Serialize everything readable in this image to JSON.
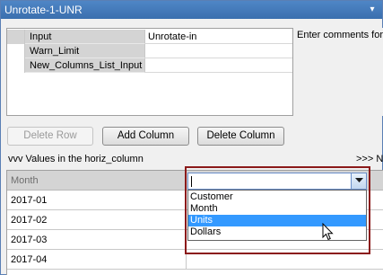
{
  "window": {
    "title": "Unrotate-1-UNR"
  },
  "params": {
    "rows": [
      {
        "key": "Input",
        "value": "Unrotate-in"
      },
      {
        "key": "Warn_Limit",
        "value": ""
      },
      {
        "key": "New_Columns_List_Input",
        "value": ""
      }
    ]
  },
  "comments": {
    "placeholder": "Enter comments for t"
  },
  "toolbar": {
    "delete_row": "Delete Row",
    "add_column": "Add Column",
    "delete_column": "Delete Column"
  },
  "section": {
    "label": "vvv Values in the horiz_column",
    "right": ">>> N"
  },
  "grid": {
    "header": "Month",
    "rows": [
      "2017-01",
      "2017-02",
      "2017-03",
      "2017-04"
    ]
  },
  "combo": {
    "value": "",
    "options": [
      "Customer",
      "Month",
      "Units",
      "Dollars"
    ],
    "selected": "Units"
  },
  "colors": {
    "highlight": "#8b1a1a",
    "selection": "#3399ff",
    "titlebar": "#4f86c6"
  }
}
